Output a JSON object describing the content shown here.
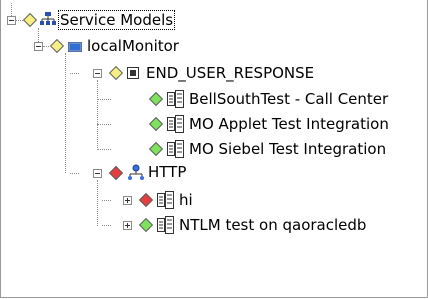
{
  "tree": {
    "root": {
      "label": "Service Models"
    },
    "monitor": {
      "label": "localMonitor"
    },
    "category": {
      "label": "END_USER_RESPONSE"
    },
    "category_items": [
      {
        "label": "BellSouthTest - Call Center"
      },
      {
        "label": "MO Applet Test Integration"
      },
      {
        "label": "MO Siebel Test Integration"
      }
    ],
    "http": {
      "label": "HTTP"
    },
    "http_items": [
      {
        "label": "hi"
      },
      {
        "label": "NTLM test on qaoracledb"
      }
    ]
  },
  "colors": {
    "status_yellow": "#f6f084",
    "status_green": "#7fe25e",
    "status_red": "#e63e3e"
  },
  "icons": {
    "root": "network-tree-icon",
    "monitor": "monitor-icon",
    "category": "category-box-icon",
    "http": "http-network-icon",
    "item": "service-model-icon"
  }
}
